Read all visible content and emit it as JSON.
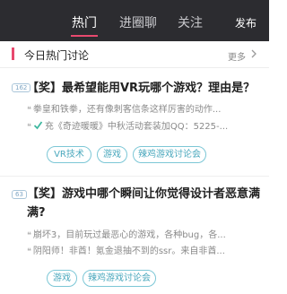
{
  "nav": {
    "tabs": [
      {
        "label": "热门",
        "active": true
      },
      {
        "label": "进圈聊",
        "active": false
      },
      {
        "label": "关注",
        "active": false
      }
    ],
    "publish_label": "发布"
  },
  "section": {
    "title": "今日热门讨论",
    "more_label": "更多"
  },
  "posts": [
    {
      "badge": "162",
      "title": "【奖】最希望能用VR玩哪个游戏？理由是？",
      "lines": [
        "拳皇和铁拳，还有像刺客信条这样厉害的动作...",
        "充《奇迹暖暖》中秋活动套装加QQ：5225-..."
      ],
      "tags": [
        "VR技术",
        "游戏",
        "辣鸡游戏讨论会"
      ]
    },
    {
      "badge": "63",
      "title": "【奖】游戏中哪个瞬间让你觉得设计者恶意满满?",
      "lines": [
        "崩坏3，目前玩过最恶心的游戏，各种bug，各...",
        "阴阳师！非酋！氪金退抽不到的ssr。来自非酋..."
      ],
      "tags": [
        "游戏",
        "辣鸡游戏讨论会"
      ]
    }
  ],
  "colors": {
    "accent": "#e8496e",
    "tag": "#4aa8bd",
    "topbar": "#2c2c30"
  },
  "icons": {
    "more": "chevron-right-icon",
    "check": "check-icon",
    "quote": "quote-icon"
  }
}
